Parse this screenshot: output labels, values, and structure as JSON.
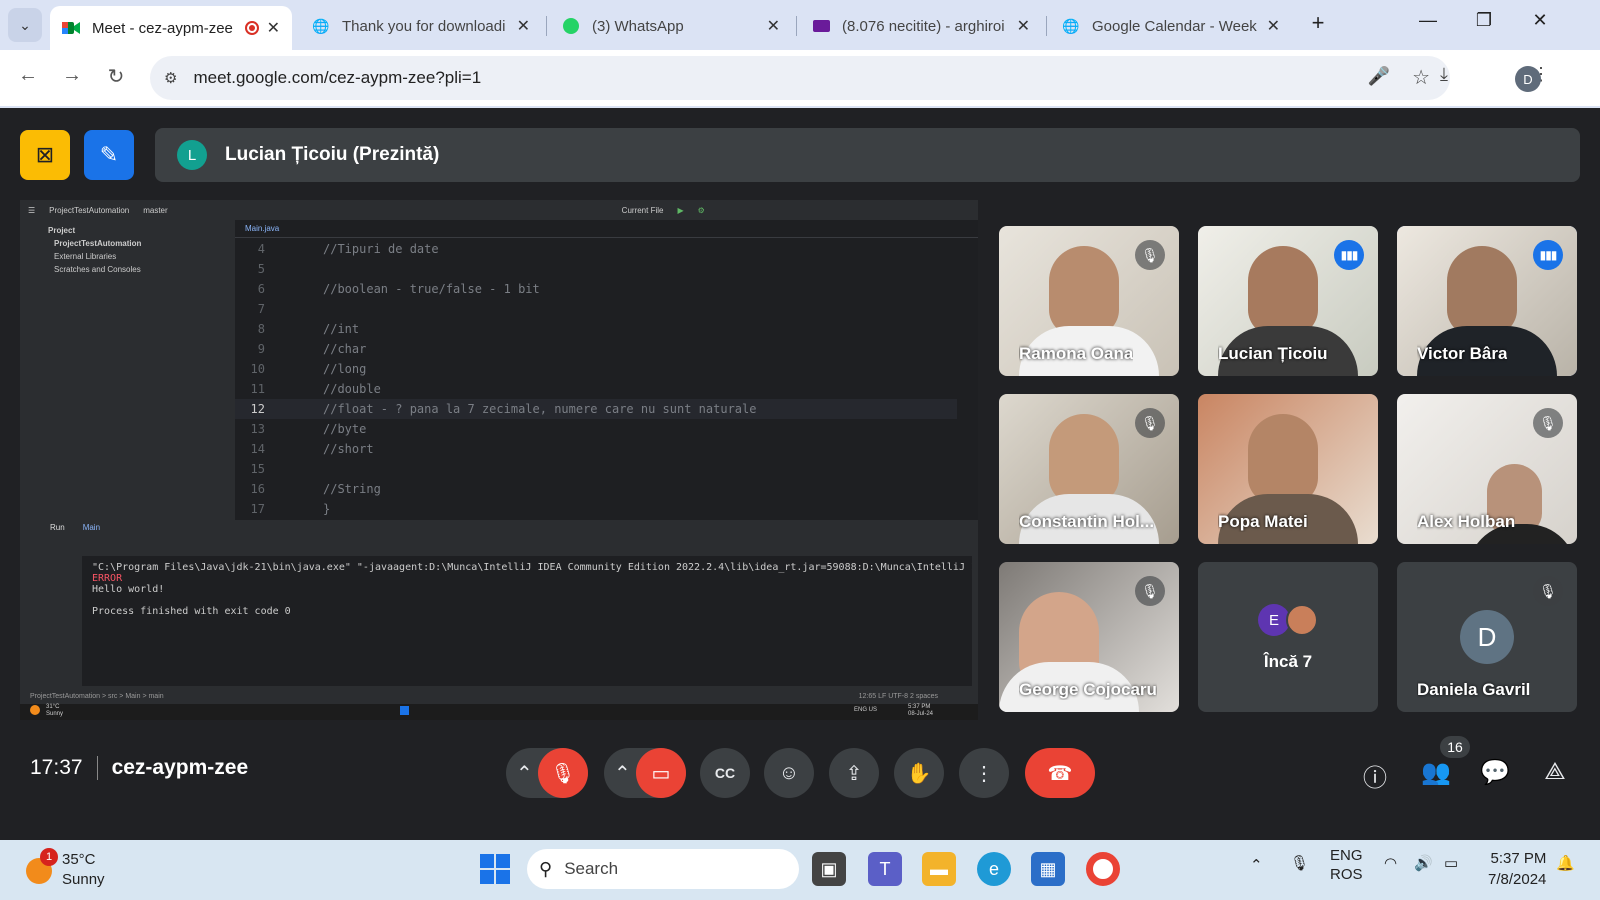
{
  "browser": {
    "tabs": [
      {
        "title": "Meet - cez-aypm-zee",
        "active": true
      },
      {
        "title": "Thank you for downloadi"
      },
      {
        "title": "(3) WhatsApp"
      },
      {
        "title": "(8.076 necitite) - arghiroi"
      },
      {
        "title": "Google Calendar - Week"
      }
    ],
    "url": "meet.google.com/cez-aypm-zee?pli=1",
    "profile_initial": "D"
  },
  "meet": {
    "presenter": {
      "initial": "L",
      "name": "Lucian Țicoiu (Prezintă)"
    },
    "meeting_time": "17:37",
    "meeting_code": "cez-aypm-zee",
    "participants_count": "16",
    "tiles": [
      {
        "name": "Ramona Oana",
        "state": "muted"
      },
      {
        "name": "Lucian Țicoiu",
        "state": "speaking"
      },
      {
        "name": "Victor Bâra",
        "state": "speaking"
      },
      {
        "name": "Constantin Hol...",
        "state": "muted"
      },
      {
        "name": "Popa Matei",
        "state": "none"
      },
      {
        "name": "Alex Holban",
        "state": "muted"
      },
      {
        "name": "George Cojocaru",
        "state": "muted"
      },
      {
        "name": "Încă 7",
        "initial": "E"
      },
      {
        "name": "Daniela Gavril",
        "initial": "D",
        "state": "muted"
      }
    ]
  },
  "ide": {
    "project_name": "ProjectTestAutomation",
    "branch": "master",
    "run_config": "Current File",
    "project_label": "Project",
    "tree": [
      "ProjectTestAutomation",
      "External Libraries",
      "Scratches and Consoles"
    ],
    "file_tab": "Main.java",
    "code_lines": [
      {
        "n": "4",
        "t": "//Tipuri de date"
      },
      {
        "n": "5",
        "t": ""
      },
      {
        "n": "6",
        "t": "//boolean - true/false - 1 bit"
      },
      {
        "n": "7",
        "t": ""
      },
      {
        "n": "8",
        "t": "//int"
      },
      {
        "n": "9",
        "t": "//char"
      },
      {
        "n": "10",
        "t": "//long"
      },
      {
        "n": "11",
        "t": "//double"
      },
      {
        "n": "12",
        "t": "//float - ? pana la 7 zecimale, numere care nu sunt naturale"
      },
      {
        "n": "13",
        "t": "//byte"
      },
      {
        "n": "14",
        "t": "//short"
      },
      {
        "n": "15",
        "t": ""
      },
      {
        "n": "16",
        "t": "//String"
      },
      {
        "n": "17",
        "t": "}"
      }
    ],
    "run_tab": "Run",
    "run_target": "Main",
    "console": {
      "cmd": "\"C:\\Program Files\\Java\\jdk-21\\bin\\java.exe\" \"-javaagent:D:\\Munca\\IntelliJ IDEA Community Edition 2022.2.4\\lib\\idea_rt.jar=59088:D:\\Munca\\IntelliJ ID",
      "error": "ERROR",
      "out": "Hello world!",
      "exit": "Process finished with exit code 0"
    },
    "statusbar": {
      "path": "ProjectTestAutomation > src > Main > main",
      "right": "12:65  LF  UTF-8  2 spaces"
    },
    "remote_taskbar": {
      "temp": "31°C",
      "cond": "Sunny",
      "lang": "ENG US",
      "time": "5:37 PM",
      "date": "08-Jul-24"
    }
  },
  "taskbar": {
    "weather_temp": "35°C",
    "weather_cond": "Sunny",
    "weather_badge": "1",
    "search_label": "Search",
    "lang_top": "ENG",
    "lang_bottom": "ROS",
    "time": "5:37 PM",
    "date": "7/8/2024"
  }
}
